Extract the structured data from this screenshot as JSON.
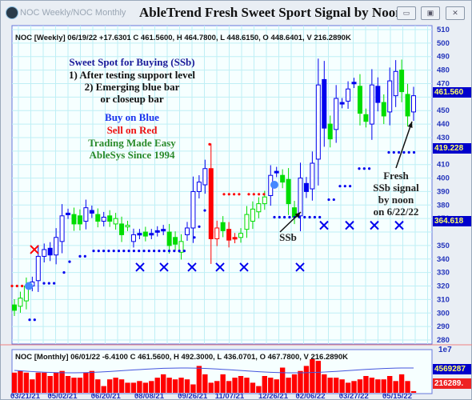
{
  "window": {
    "app_title": "NOC Weekly/NOC Monthly",
    "headline": "AbleTrend Fresh Sweet Sport Signal by Noon",
    "minimize": "▭",
    "maximize": "▣",
    "close": "✕"
  },
  "price_panel": {
    "info": "NOC [Weekly] 06/19/22  +17.6301 C 461.5600, H 464.7800, L 448.6150, O 448.6401, V 216.2890K",
    "y_ticks": [
      510,
      500,
      490,
      480,
      470,
      450,
      440,
      430,
      410,
      400,
      390,
      380,
      370,
      350,
      340,
      330,
      320,
      310,
      300,
      290,
      280
    ],
    "tags": [
      {
        "value": "461.560",
        "bg": "#0000cc",
        "fg": "#ffff66"
      },
      {
        "value": "419.228",
        "bg": "#0000cc",
        "fg": "#ffff66"
      },
      {
        "value": "364.618",
        "bg": "#0000cc",
        "fg": "#ffff66"
      }
    ]
  },
  "annotations": {
    "title": "Sweet Spot for Buying (SSb)",
    "line1": "1) After testing support level",
    "line2": "2) Emerging blue bar",
    "line3": "or closeup bar",
    "buy": "Buy on Blue",
    "sell": "Sell on Red",
    "tme": "Trading Made Easy",
    "since": "AbleSys Since 1994",
    "ssb": "SSb",
    "fresh1": "Fresh",
    "fresh2": "SSb signal",
    "fresh3": "by noon",
    "fresh4": "on 6/22/22"
  },
  "volume_panel": {
    "info": "NOC [Monthly] 06/01/22  -6.4100 C 461.5600, H 492.3000, L 436.0701, O 467.7800, V 216.2890K",
    "scale": "1e7",
    "tags": [
      {
        "value": "4569287",
        "bg": "#0000cc",
        "fg": "#ffff66"
      },
      {
        "value": "216289.",
        "bg": "#ee2222",
        "fg": "#ffffff"
      }
    ]
  },
  "x_labels": [
    "03/21/21",
    "05/02/21",
    "06/20/21",
    "08/08/21",
    "09/26/21",
    "11/07/21",
    "12/26/21",
    "02/06/22",
    "03/27/22",
    "05/15/22"
  ],
  "colors": {
    "up": "#00dd00",
    "blue": "#0000ee",
    "red": "#ff0000",
    "grid": "#bfeff5",
    "axis": "#2233bb"
  },
  "chart_data": {
    "type": "candlestick",
    "ylim": [
      280,
      510
    ],
    "candles_body_low_high_style": [
      [
        302,
        306,
        "g"
      ],
      [
        305,
        311,
        "gh"
      ],
      [
        309,
        320,
        "gh"
      ],
      [
        320,
        323,
        "bh"
      ],
      [
        324,
        342,
        "bh"
      ],
      [
        342,
        347,
        "bh"
      ],
      [
        343,
        348,
        "b"
      ],
      [
        343,
        356,
        "bh"
      ],
      [
        353,
        372,
        "bh"
      ],
      [
        373,
        374,
        "b"
      ],
      [
        366,
        373,
        "g"
      ],
      [
        366,
        372,
        "g"
      ],
      [
        368,
        378,
        "bh"
      ],
      [
        374,
        376,
        "b"
      ],
      [
        368,
        373,
        "g"
      ],
      [
        368,
        371,
        "bh"
      ],
      [
        368,
        372,
        "g"
      ],
      [
        366,
        370,
        "gh"
      ],
      [
        358,
        366,
        "g"
      ],
      [
        364,
        365,
        "gh"
      ],
      [
        353,
        358,
        "bh"
      ],
      [
        358,
        359,
        "b"
      ],
      [
        357,
        360,
        "g"
      ],
      [
        358,
        359,
        "b"
      ],
      [
        360,
        361,
        "b"
      ],
      [
        361,
        362,
        "b"
      ],
      [
        350,
        360,
        "g"
      ],
      [
        351,
        356,
        "g"
      ],
      [
        345,
        353,
        "gh"
      ],
      [
        358,
        363,
        "bh"
      ],
      [
        363,
        390,
        "bh"
      ],
      [
        390,
        397,
        "bh"
      ],
      [
        395,
        407,
        "bh"
      ],
      [
        355,
        407,
        "r"
      ],
      [
        355,
        363,
        "rh"
      ],
      [
        361,
        367,
        "g"
      ],
      [
        354,
        362,
        "r"
      ],
      [
        355,
        356,
        "r"
      ],
      [
        356,
        359,
        "gh"
      ],
      [
        362,
        373,
        "gh"
      ],
      [
        368,
        377,
        "gh"
      ],
      [
        375,
        381,
        "gh"
      ],
      [
        381,
        386,
        "gh"
      ],
      [
        387,
        402,
        "bh"
      ],
      [
        404,
        405,
        "b"
      ],
      [
        397,
        402,
        "g"
      ],
      [
        381,
        399,
        "g"
      ],
      [
        371,
        378,
        "g"
      ],
      [
        372,
        400,
        "bh"
      ],
      [
        390,
        396,
        "b"
      ],
      [
        392,
        411,
        "bh"
      ],
      [
        414,
        469,
        "bh"
      ],
      [
        437,
        473,
        "b"
      ],
      [
        429,
        440,
        "g"
      ],
      [
        436,
        459,
        "bh"
      ],
      [
        455,
        456,
        "b"
      ],
      [
        457,
        466,
        "bh"
      ],
      [
        470,
        471,
        "b"
      ],
      [
        448,
        468,
        "g"
      ],
      [
        442,
        447,
        "g"
      ],
      [
        440,
        469,
        "bh"
      ],
      [
        456,
        468,
        "b"
      ],
      [
        446,
        456,
        "g"
      ],
      [
        449,
        472,
        "bh"
      ],
      [
        461,
        479,
        "bh"
      ],
      [
        464,
        480,
        "g"
      ],
      [
        446,
        462,
        "g"
      ],
      [
        449,
        461,
        "bh"
      ]
    ],
    "volume_relative": [
      0.6,
      0.65,
      0.6,
      0.4,
      0.6,
      0.6,
      0.5,
      0.6,
      0.65,
      0.5,
      0.45,
      0.45,
      0.6,
      0.65,
      0.4,
      0.2,
      0.4,
      0.45,
      0.4,
      0.3,
      0.3,
      0.35,
      0.3,
      0.35,
      0.45,
      0.55,
      0.45,
      0.4,
      0.45,
      0.4,
      0.25,
      0.8,
      0.55,
      0.3,
      0.35,
      0.55,
      0.35,
      0.45,
      0.5,
      0.45,
      0.3,
      0.2,
      0.5,
      0.45,
      0.4,
      0.75,
      0.45,
      0.55,
      0.65,
      0.8,
      1.0,
      0.95,
      0.55,
      0.45,
      0.45,
      0.4,
      0.3,
      0.35,
      0.4,
      0.5,
      0.45,
      0.4,
      0.4,
      0.5,
      0.35,
      0.55,
      0.35,
      0.05
    ]
  }
}
